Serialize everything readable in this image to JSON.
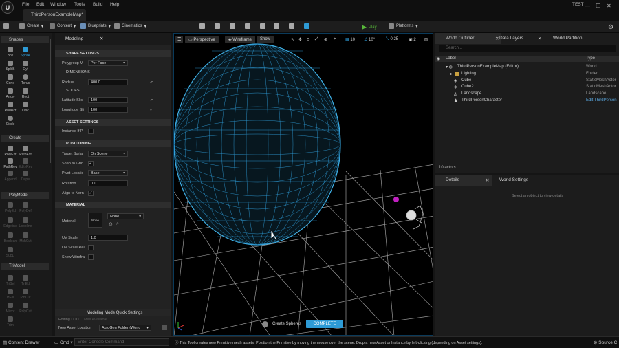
{
  "menu": {
    "items": [
      "File",
      "Edit",
      "Window",
      "Tools",
      "Build",
      "Help"
    ],
    "test_label": "TEST"
  },
  "tab": {
    "title": "ThirdPersonExampleMap*"
  },
  "toolbar": {
    "create": "Create",
    "content": "Content",
    "blueprints": "Blueprints",
    "cinematics": "Cinematics",
    "play": "Play",
    "platforms": "Platforms",
    "colors": {
      "play": "#58b83a",
      "accent": "#2e9bd6"
    }
  },
  "shapes": {
    "header": "Shapes",
    "tools": [
      {
        "label": "Box",
        "icon": "box-icon"
      },
      {
        "label": "SphrA",
        "icon": "sphere-icon"
      },
      {
        "label": "SplitB",
        "icon": "split-icon"
      },
      {
        "label": "Cyl",
        "icon": "cylinder-icon"
      },
      {
        "label": "Cone",
        "icon": "cone-icon"
      },
      {
        "label": "Torus",
        "icon": "torus-icon"
      },
      {
        "label": "Arrow",
        "icon": "arrow-icon"
      },
      {
        "label": "Rect",
        "icon": "rect-icon"
      },
      {
        "label": "RndRct",
        "icon": "rounded-rect-icon"
      },
      {
        "label": "Disc",
        "icon": "disc-icon"
      },
      {
        "label": "Circle",
        "icon": "circle-icon"
      }
    ]
  },
  "create_section": {
    "header": "Create",
    "tools": [
      "PolyExt",
      "PathExt",
      "PathRev",
      "EdityRev",
      "Append",
      "Dupe"
    ]
  },
  "polymodel": {
    "header": "PolyModel",
    "tools": [
      "PolyEd",
      "PolyDef",
      "Edgeline",
      "Loopline",
      "Boolean",
      "MshCut",
      "SubD"
    ]
  },
  "trimodel": {
    "header": "TriModel",
    "tools": [
      "TriSel",
      "TriEd",
      "HFill",
      "PlnCut",
      "Mirror",
      "PolyCut",
      "Trim"
    ]
  },
  "modeling": {
    "tab": "Modeling",
    "shape_settings": "SHAPE SETTINGS",
    "polygroup_label": "Polygroup M",
    "polygroup_value": "Per Face",
    "dimensions": "DIMENSIONS",
    "radius_label": "Radius",
    "radius_value": "400.0",
    "slices": "SLICES",
    "lat_label": "Latitude Slic",
    "lat_value": "100",
    "lon_label": "Longitude Sli",
    "lon_value": "100",
    "asset_settings": "ASSET SETTINGS",
    "instance_label": "Instance If P",
    "positioning": "POSITIONING",
    "target_label": "Target Surfa",
    "target_value": "On Scene",
    "snap_label": "Snap to Grid",
    "pivot_label": "Pivot Locatic",
    "pivot_value": "Base",
    "rotation_label": "Rotation",
    "rotation_value": "0.0",
    "align_label": "Align to Norn",
    "material": "MATERIAL",
    "material_label": "Material",
    "material_thumb": "None",
    "material_value": "None",
    "uvscale_label": "UV Scale",
    "uvscale_value": "1.0",
    "uvrel_label": "UV Scale Rel",
    "wire_label": "Show Wirefra",
    "quick_settings": "Modeling Mode Quick Settings",
    "editing_lod": "Editing LOD",
    "lod_value": "Max Available",
    "new_asset_label": "New Asset Location",
    "new_asset_value": "AutoGen Folder (Worlc"
  },
  "viewport": {
    "perspective": "Perspective",
    "wireframe": "Wireframe",
    "show": "Show",
    "grid_size": "10",
    "angle": "10°",
    "scale": "0.25",
    "cam_speed": "2",
    "create_label": "Create Spheres",
    "complete_label": "COMPLETE"
  },
  "outliner": {
    "tabs": [
      "World Outliner",
      "Data Layers",
      "World Partition"
    ],
    "search_placeholder": "Search...",
    "col_label": "Label",
    "col_type": "Type",
    "rows": [
      {
        "label": "ThirdPersonExampleMap (Editor)",
        "type": "World"
      },
      {
        "label": "Lighting",
        "type": "Folder"
      },
      {
        "label": "Cube",
        "type": "StaticMeshActor"
      },
      {
        "label": "Cube2",
        "type": "StaticMeshActor"
      },
      {
        "label": "Landscape",
        "type": "Landscape"
      },
      {
        "label": "ThirdPersonCharacter",
        "type": "Edit ThirdPerson"
      }
    ],
    "count": "10 actors"
  },
  "details": {
    "tabs": [
      "Details",
      "World Settings"
    ],
    "empty_msg": "Select an object to view details"
  },
  "status": {
    "content_drawer": "Content Drawer",
    "cmd": "Cmd",
    "console_placeholder": "Enter Console Command",
    "message": "This Tool creates new Primitive mesh assets. Position the Primitive by moving the mouse over the scene. Drop a new Asset or Instance by left-clicking (depending on Asset settings).",
    "source": "Source C"
  }
}
